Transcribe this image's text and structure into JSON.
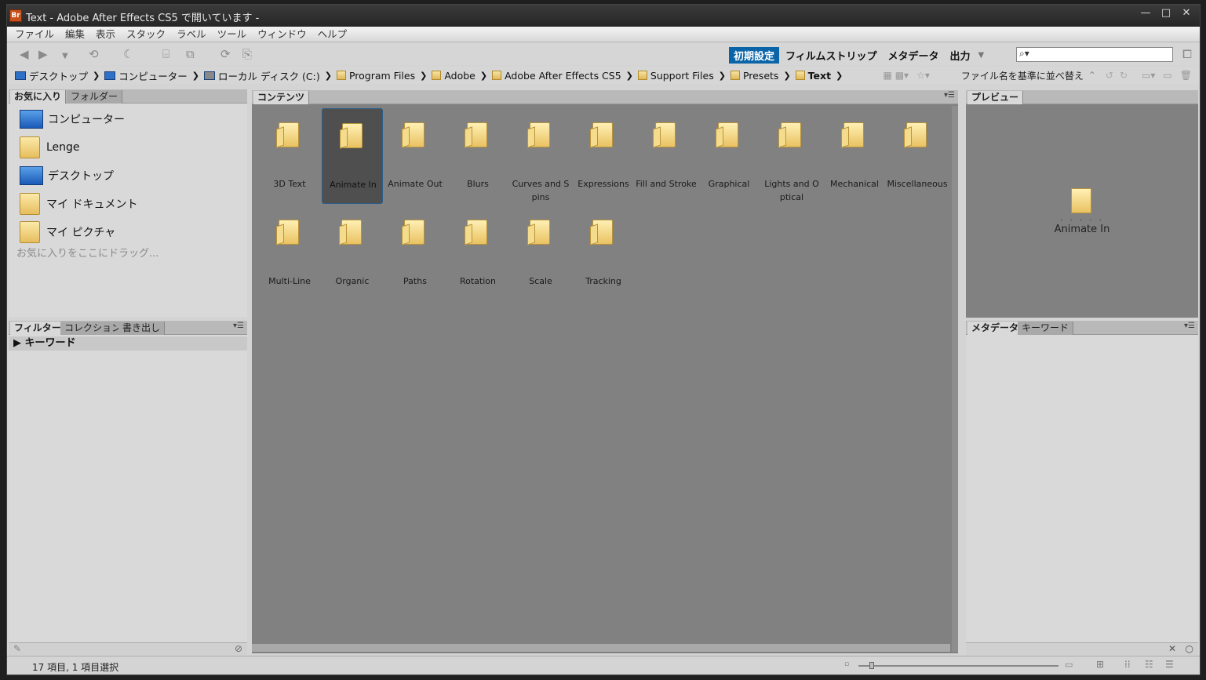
{
  "titlebar": {
    "title": "Text - Adobe After Effects CS5 で開いています -",
    "app_icon": "Br",
    "minimize": "—",
    "maximize": "□",
    "close": "✕"
  },
  "menu": [
    "ファイル",
    "編集",
    "表示",
    "スタック",
    "ラベル",
    "ツール",
    "ウィンドウ",
    "ヘルプ"
  ],
  "workspaces": {
    "active": "初期設定",
    "items": [
      "フィルムストリップ",
      "メタデータ",
      "出力"
    ]
  },
  "search": {
    "placeholder": "",
    "icon": "⌕▾"
  },
  "path": [
    {
      "label": "デスクトップ",
      "type": "pc"
    },
    {
      "label": "コンピューター",
      "type": "pc"
    },
    {
      "label": "ローカル ディスク (C:)",
      "type": "disk"
    },
    {
      "label": "Program Files",
      "type": "folder"
    },
    {
      "label": "Adobe",
      "type": "folder"
    },
    {
      "label": "Adobe After Effects CS5",
      "type": "folder"
    },
    {
      "label": "Support Files",
      "type": "folder"
    },
    {
      "label": "Presets",
      "type": "folder"
    },
    {
      "label": "Text",
      "type": "folder"
    }
  ],
  "sort_label": "ファイル名を基準に並べ替え",
  "left_tabs": {
    "top": [
      "お気に入り",
      "フォルダー"
    ],
    "bottom": [
      "フィルター",
      "コレクション",
      "書き出し"
    ]
  },
  "favorites": [
    "コンピューター",
    "Lenge",
    "デスクトップ",
    "マイ ドキュメント",
    "マイ ピクチャ"
  ],
  "favorites_hint": "お気に入りをここにドラッグ...",
  "filter": {
    "keyword": "キーワード"
  },
  "content_tab": "コンテンツ",
  "items": [
    "3D Text",
    "Animate In",
    "Animate Out",
    "Blurs",
    "Curves and S\npins",
    "Expressions",
    "Fill and Stroke",
    "Graphical",
    "Lights and O\nptical",
    "Mechanical",
    "Miscellaneous",
    "Multi-Line",
    "Organic",
    "Paths",
    "Rotation",
    "Scale",
    "Tracking"
  ],
  "selected_item": "Animate In",
  "preview_tab": "プレビュー",
  "preview_label": "Animate In",
  "preview_dots": ". . . . .",
  "meta_tabs": [
    "メタデータ",
    "キーワード"
  ],
  "status": "17 項目, 1 項目選択"
}
